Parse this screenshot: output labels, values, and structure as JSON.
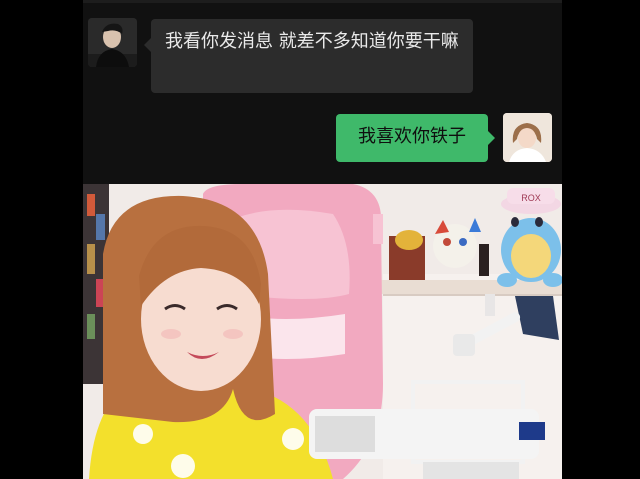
{
  "chat": {
    "incoming_message": "我看你发消息 就差不多知道你要干嘛",
    "outgoing_message": "我喜欢你铁子"
  },
  "colors": {
    "chat_background": "#111111",
    "incoming_bubble": "#2c2c2c",
    "outgoing_bubble": "#3fb96a",
    "letterbox": "#000000"
  },
  "video": {
    "figurine_hat_text": "ROX"
  }
}
